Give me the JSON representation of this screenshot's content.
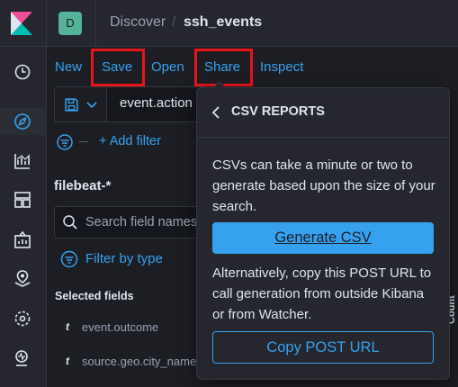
{
  "app": {
    "space_initial": "D",
    "breadcrumbs": [
      "Discover",
      "ssh_events"
    ],
    "breadcrumb_separator": "/"
  },
  "colors": {
    "accent": "#36a2ef",
    "background": "#1d1e24",
    "panel": "#25262e",
    "highlight_box": "#e7141a",
    "space_avatar": "#54b399"
  },
  "nav_icons": [
    "clock-icon",
    "compass-icon",
    "visualize-icon",
    "dashboard-icon",
    "canvas-icon",
    "maps-icon",
    "ml-icon",
    "uptime-icon"
  ],
  "toolbar": {
    "new": "New",
    "save": "Save",
    "open": "Open",
    "share": "Share",
    "inspect": "Inspect"
  },
  "query": {
    "text": "event.action"
  },
  "filters": {
    "add_label": "+ Add filter"
  },
  "sidebar": {
    "index_pattern": "filebeat-*",
    "search_placeholder": "Search field names",
    "filter_by_type": "Filter by type",
    "selected_fields_title": "Selected fields",
    "fields": [
      {
        "type": "t",
        "name": "event.outcome"
      },
      {
        "type": "t",
        "name": "source.geo.city_name"
      }
    ]
  },
  "right_strip_label": "Count",
  "popover": {
    "title": "CSV REPORTS",
    "description": "CSVs can take a minute or two to generate based upon the size of your search.",
    "generate_button": "Generate CSV",
    "alternative_text": "Alternatively, copy this POST URL to call generation from outside Kibana or from Watcher.",
    "copy_button": "Copy POST URL"
  }
}
